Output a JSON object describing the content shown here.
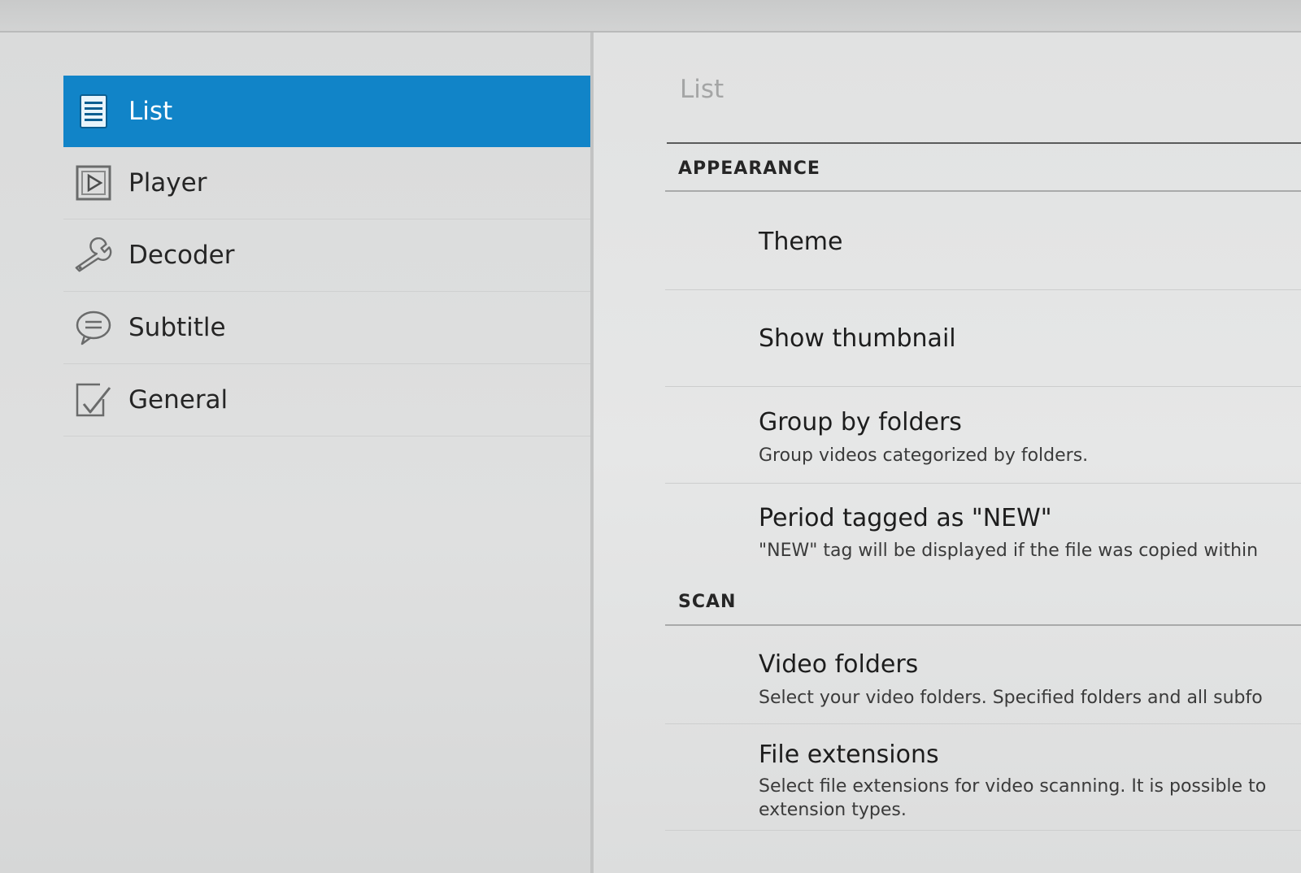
{
  "sidebar": {
    "items": [
      {
        "label": "List",
        "icon": "list-icon"
      },
      {
        "label": "Player",
        "icon": "play-icon"
      },
      {
        "label": "Decoder",
        "icon": "wrench-icon"
      },
      {
        "label": "Subtitle",
        "icon": "speech-bubble-icon"
      },
      {
        "label": "General",
        "icon": "checkbox-icon"
      }
    ],
    "active_color": "#1184c8"
  },
  "main": {
    "title": "List",
    "sections": [
      {
        "header": "APPEARANCE",
        "items": [
          {
            "title": "Theme",
            "summary": ""
          },
          {
            "title": "Show thumbnail",
            "summary": ""
          },
          {
            "title": "Group by folders",
            "summary": "Group videos categorized by folders."
          },
          {
            "title": "Period tagged as \"NEW\"",
            "summary": "\"NEW\" tag will be displayed if the file was copied within"
          }
        ]
      },
      {
        "header": "SCAN",
        "items": [
          {
            "title": "Video folders",
            "summary": "Select your video folders. Specified folders and all subfo"
          },
          {
            "title": "File extensions",
            "summary": "Select file extensions for video scanning. It is possible to extension types."
          }
        ]
      }
    ]
  }
}
